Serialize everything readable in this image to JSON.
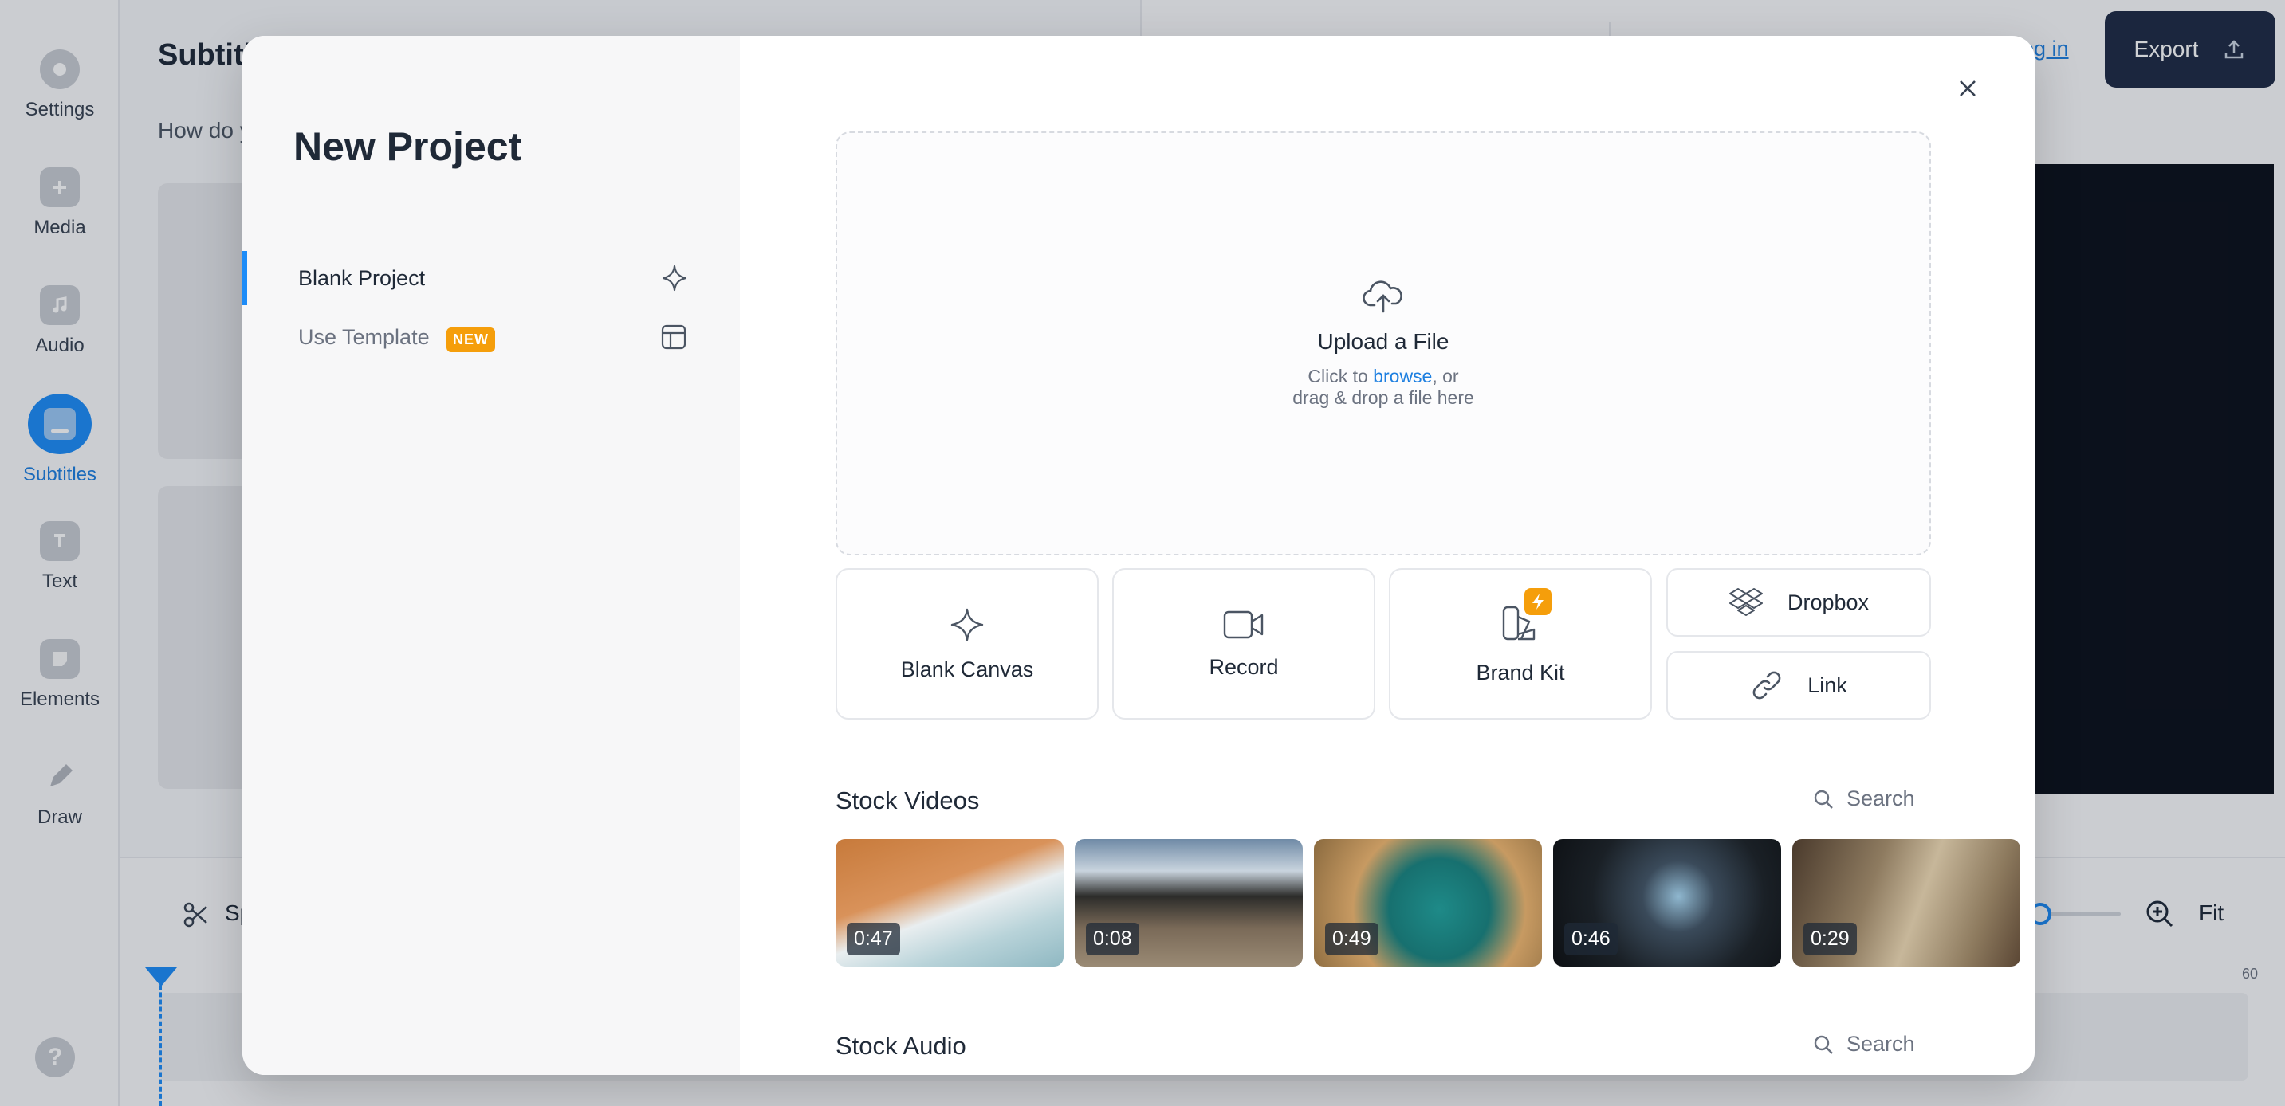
{
  "sidebar": {
    "items": [
      {
        "label": "Settings",
        "icon": "settings-icon"
      },
      {
        "label": "Media",
        "icon": "plus-icon"
      },
      {
        "label": "Audio",
        "icon": "music-note-icon"
      },
      {
        "label": "Subtitles",
        "icon": "subtitles-icon",
        "active": true
      },
      {
        "label": "Text",
        "icon": "text-icon"
      },
      {
        "label": "Elements",
        "icon": "elements-icon"
      },
      {
        "label": "Draw",
        "icon": "pencil-icon"
      }
    ],
    "help": "?"
  },
  "background": {
    "title": "Subtitl",
    "subtitle": "How do y",
    "login": "log in",
    "export": "Export",
    "split": "Sp",
    "fit": "Fit",
    "tick_60": "60"
  },
  "modal": {
    "title": "New Project",
    "nav": [
      {
        "label": "Blank Project",
        "icon": "sparkle-icon",
        "active": true
      },
      {
        "label": "Use Template",
        "badge": "NEW",
        "icon": "template-icon"
      }
    ],
    "upload": {
      "title": "Upload a File",
      "hint_pre": "Click to ",
      "hint_link": "browse",
      "hint_post": ", or",
      "hint_line2": "drag & drop a file here"
    },
    "tiles": [
      {
        "label": "Blank Canvas",
        "icon": "sparkle-icon"
      },
      {
        "label": "Record",
        "icon": "video-camera-icon"
      },
      {
        "label": "Brand Kit",
        "icon": "brand-kit-icon"
      }
    ],
    "mini_tiles": [
      {
        "label": "Dropbox",
        "icon": "dropbox-icon"
      },
      {
        "label": "Link",
        "icon": "link-icon"
      }
    ],
    "stock_videos": {
      "title": "Stock Videos",
      "search_placeholder": "Search",
      "items": [
        {
          "duration": "0:47"
        },
        {
          "duration": "0:08"
        },
        {
          "duration": "0:49"
        },
        {
          "duration": "0:46"
        },
        {
          "duration": "0:29"
        }
      ]
    },
    "stock_audio": {
      "title": "Stock Audio",
      "search_placeholder": "Search"
    }
  }
}
